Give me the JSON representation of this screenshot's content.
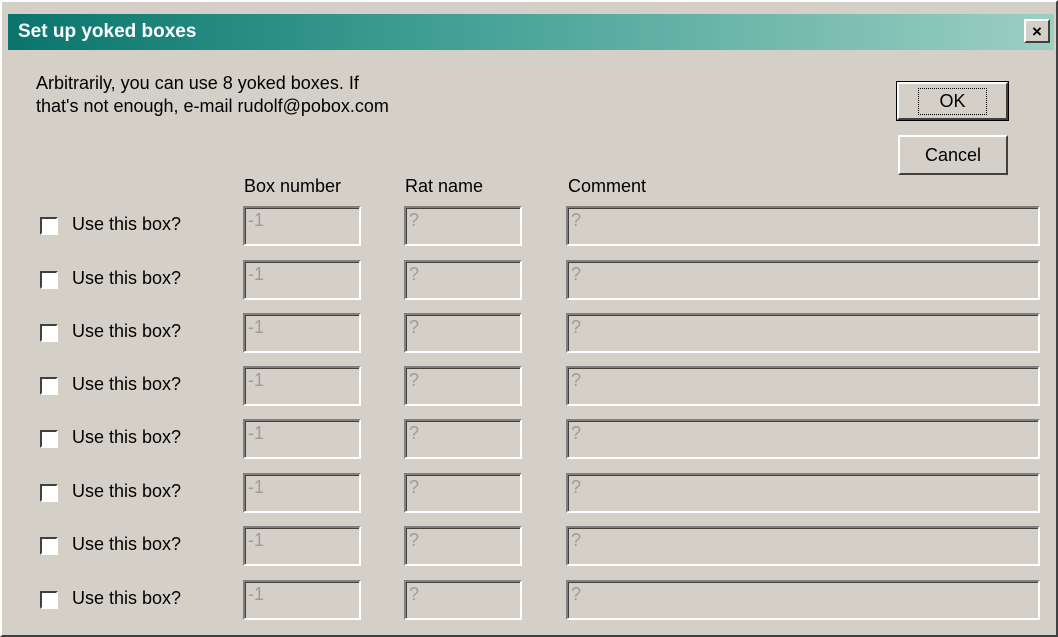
{
  "window": {
    "title": "Set up yoked boxes",
    "close_label": "×"
  },
  "message": {
    "line1": "Arbitrarily, you can use 8 yoked boxes. If",
    "line2": "that's not enough, e-mail rudolf@pobox.com"
  },
  "buttons": {
    "ok": "OK",
    "cancel": "Cancel"
  },
  "columns": {
    "box_number": "Box number",
    "rat_name": "Rat name",
    "comment": "Comment"
  },
  "rows": [
    {
      "checkbox_label": "Use this box?",
      "checked": false,
      "box_number": "-1",
      "rat_name": "?",
      "comment": "?"
    },
    {
      "checkbox_label": "Use this box?",
      "checked": false,
      "box_number": "-1",
      "rat_name": "?",
      "comment": "?"
    },
    {
      "checkbox_label": "Use this box?",
      "checked": false,
      "box_number": "-1",
      "rat_name": "?",
      "comment": "?"
    },
    {
      "checkbox_label": "Use this box?",
      "checked": false,
      "box_number": "-1",
      "rat_name": "?",
      "comment": "?"
    },
    {
      "checkbox_label": "Use this box?",
      "checked": false,
      "box_number": "-1",
      "rat_name": "?",
      "comment": "?"
    },
    {
      "checkbox_label": "Use this box?",
      "checked": false,
      "box_number": "-1",
      "rat_name": "?",
      "comment": "?"
    },
    {
      "checkbox_label": "Use this box?",
      "checked": false,
      "box_number": "-1",
      "rat_name": "?",
      "comment": "?"
    },
    {
      "checkbox_label": "Use this box?",
      "checked": false,
      "box_number": "-1",
      "rat_name": "?",
      "comment": "?"
    }
  ],
  "colors": {
    "title_start": "#0a746c",
    "title_end": "#9ccfc3",
    "face": "#d4d0c8",
    "disabled_text": "#a09c94"
  }
}
